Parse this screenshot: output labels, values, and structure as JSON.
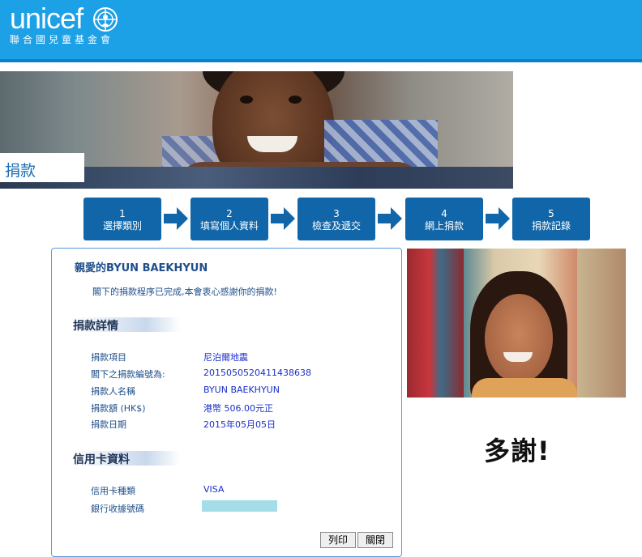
{
  "header": {
    "logo_text": "unicef",
    "logo_sub": "聯合國兒童基金會"
  },
  "page_label": "捐款",
  "steps": [
    {
      "num": "1",
      "label": "選擇類別"
    },
    {
      "num": "2",
      "label": "填寫個人資料"
    },
    {
      "num": "3",
      "label": "檢查及遞交"
    },
    {
      "num": "4",
      "label": "網上捐款"
    },
    {
      "num": "5",
      "label": "捐款記錄"
    }
  ],
  "panel": {
    "greeting": "親愛的BYUN BAEKHYUN",
    "message": "閣下的捐款程序已完成,本會衷心感謝你的捐款!",
    "donation_section": {
      "title": "捐款詳情",
      "rows": [
        {
          "label": "捐款項目",
          "value": "尼泊爾地震"
        },
        {
          "label": "閣下之捐款編號為:",
          "value": "201505052041143863​8"
        },
        {
          "label": "捐款人名稱",
          "value": "BYUN BAEKHYUN"
        },
        {
          "label": "捐款額 (HK$)",
          "value": "港幣 506.00元正"
        },
        {
          "label": "捐款日期",
          "value": "2015年05月05日"
        }
      ]
    },
    "card_section": {
      "title": "信用卡資料",
      "rows": [
        {
          "label": "信用卡種類",
          "value": "VISA"
        },
        {
          "label": "銀行收據號碼",
          "value": ""
        }
      ]
    },
    "buttons": {
      "print": "列印",
      "close": "關閉"
    }
  },
  "thanks_text": "多謝!",
  "colors": {
    "header_bg": "#1ca0e6",
    "step_bg": "#1066a8",
    "masked_field": "#a4dce8"
  }
}
